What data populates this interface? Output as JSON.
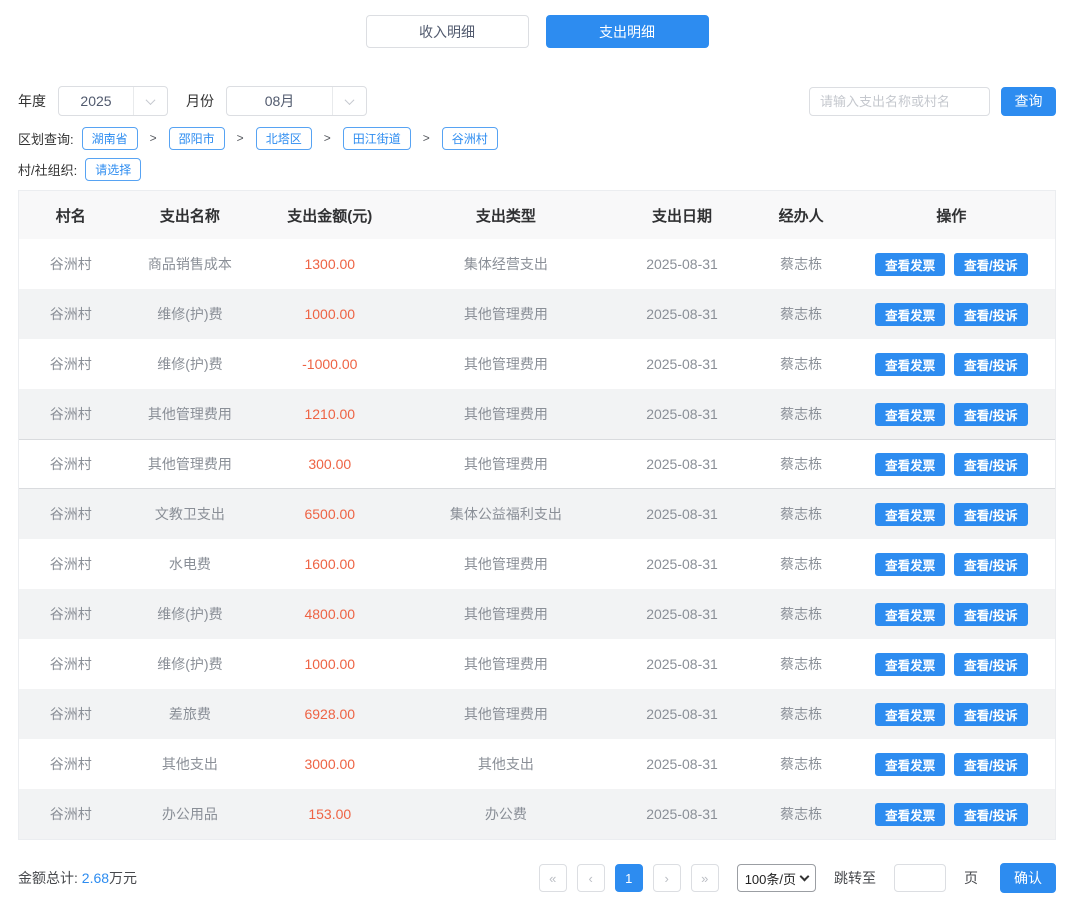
{
  "tabs": {
    "income": "收入明细",
    "expense": "支出明细"
  },
  "filters": {
    "year_label": "年度",
    "year_value": "2025",
    "month_label": "月份",
    "month_value": "08月",
    "search_placeholder": "请输入支出名称或村名",
    "search_button": "查询"
  },
  "region": {
    "label": "区划查询:",
    "separator": ">",
    "items": [
      "湖南省",
      "邵阳市",
      "北塔区",
      "田江街道",
      "谷洲村"
    ]
  },
  "org": {
    "label": "村/社组织:",
    "button": "请选择"
  },
  "table": {
    "headers": [
      "村名",
      "支出名称",
      "支出金额(元)",
      "支出类型",
      "支出日期",
      "经办人",
      "操作"
    ],
    "action_labels": {
      "invoice": "查看发票",
      "complaint": "查看/投诉"
    },
    "highlighted_row_index": 4,
    "rows": [
      {
        "village": "谷洲村",
        "name": "商品销售成本",
        "amount": "1300.00",
        "type": "集体经营支出",
        "date": "2025-08-31",
        "operator": "蔡志栋"
      },
      {
        "village": "谷洲村",
        "name": "维修(护)费",
        "amount": "1000.00",
        "type": "其他管理费用",
        "date": "2025-08-31",
        "operator": "蔡志栋"
      },
      {
        "village": "谷洲村",
        "name": "维修(护)费",
        "amount": "-1000.00",
        "type": "其他管理费用",
        "date": "2025-08-31",
        "operator": "蔡志栋"
      },
      {
        "village": "谷洲村",
        "name": "其他管理费用",
        "amount": "1210.00",
        "type": "其他管理费用",
        "date": "2025-08-31",
        "operator": "蔡志栋"
      },
      {
        "village": "谷洲村",
        "name": "其他管理费用",
        "amount": "300.00",
        "type": "其他管理费用",
        "date": "2025-08-31",
        "operator": "蔡志栋"
      },
      {
        "village": "谷洲村",
        "name": "文教卫支出",
        "amount": "6500.00",
        "type": "集体公益福利支出",
        "date": "2025-08-31",
        "operator": "蔡志栋"
      },
      {
        "village": "谷洲村",
        "name": "水电费",
        "amount": "1600.00",
        "type": "其他管理费用",
        "date": "2025-08-31",
        "operator": "蔡志栋"
      },
      {
        "village": "谷洲村",
        "name": "维修(护)费",
        "amount": "4800.00",
        "type": "其他管理费用",
        "date": "2025-08-31",
        "operator": "蔡志栋"
      },
      {
        "village": "谷洲村",
        "name": "维修(护)费",
        "amount": "1000.00",
        "type": "其他管理费用",
        "date": "2025-08-31",
        "operator": "蔡志栋"
      },
      {
        "village": "谷洲村",
        "name": "差旅费",
        "amount": "6928.00",
        "type": "其他管理费用",
        "date": "2025-08-31",
        "operator": "蔡志栋"
      },
      {
        "village": "谷洲村",
        "name": "其他支出",
        "amount": "3000.00",
        "type": "其他支出",
        "date": "2025-08-31",
        "operator": "蔡志栋"
      },
      {
        "village": "谷洲村",
        "name": "办公用品",
        "amount": "153.00",
        "type": "办公费",
        "date": "2025-08-31",
        "operator": "蔡志栋"
      }
    ]
  },
  "footer": {
    "total_label": "金额总计:",
    "total_value": "2.68",
    "total_unit": "万元",
    "pagination": {
      "first": "«",
      "prev": "‹",
      "page": "1",
      "next": "›",
      "last": "»",
      "page_size": "100条/页",
      "jump_label": "跳转至",
      "jump_unit": "页",
      "confirm": "确认"
    }
  },
  "colors": {
    "primary": "#2d8cf0",
    "amount": "#ee6344",
    "crumb_border": "#57a3f3"
  }
}
